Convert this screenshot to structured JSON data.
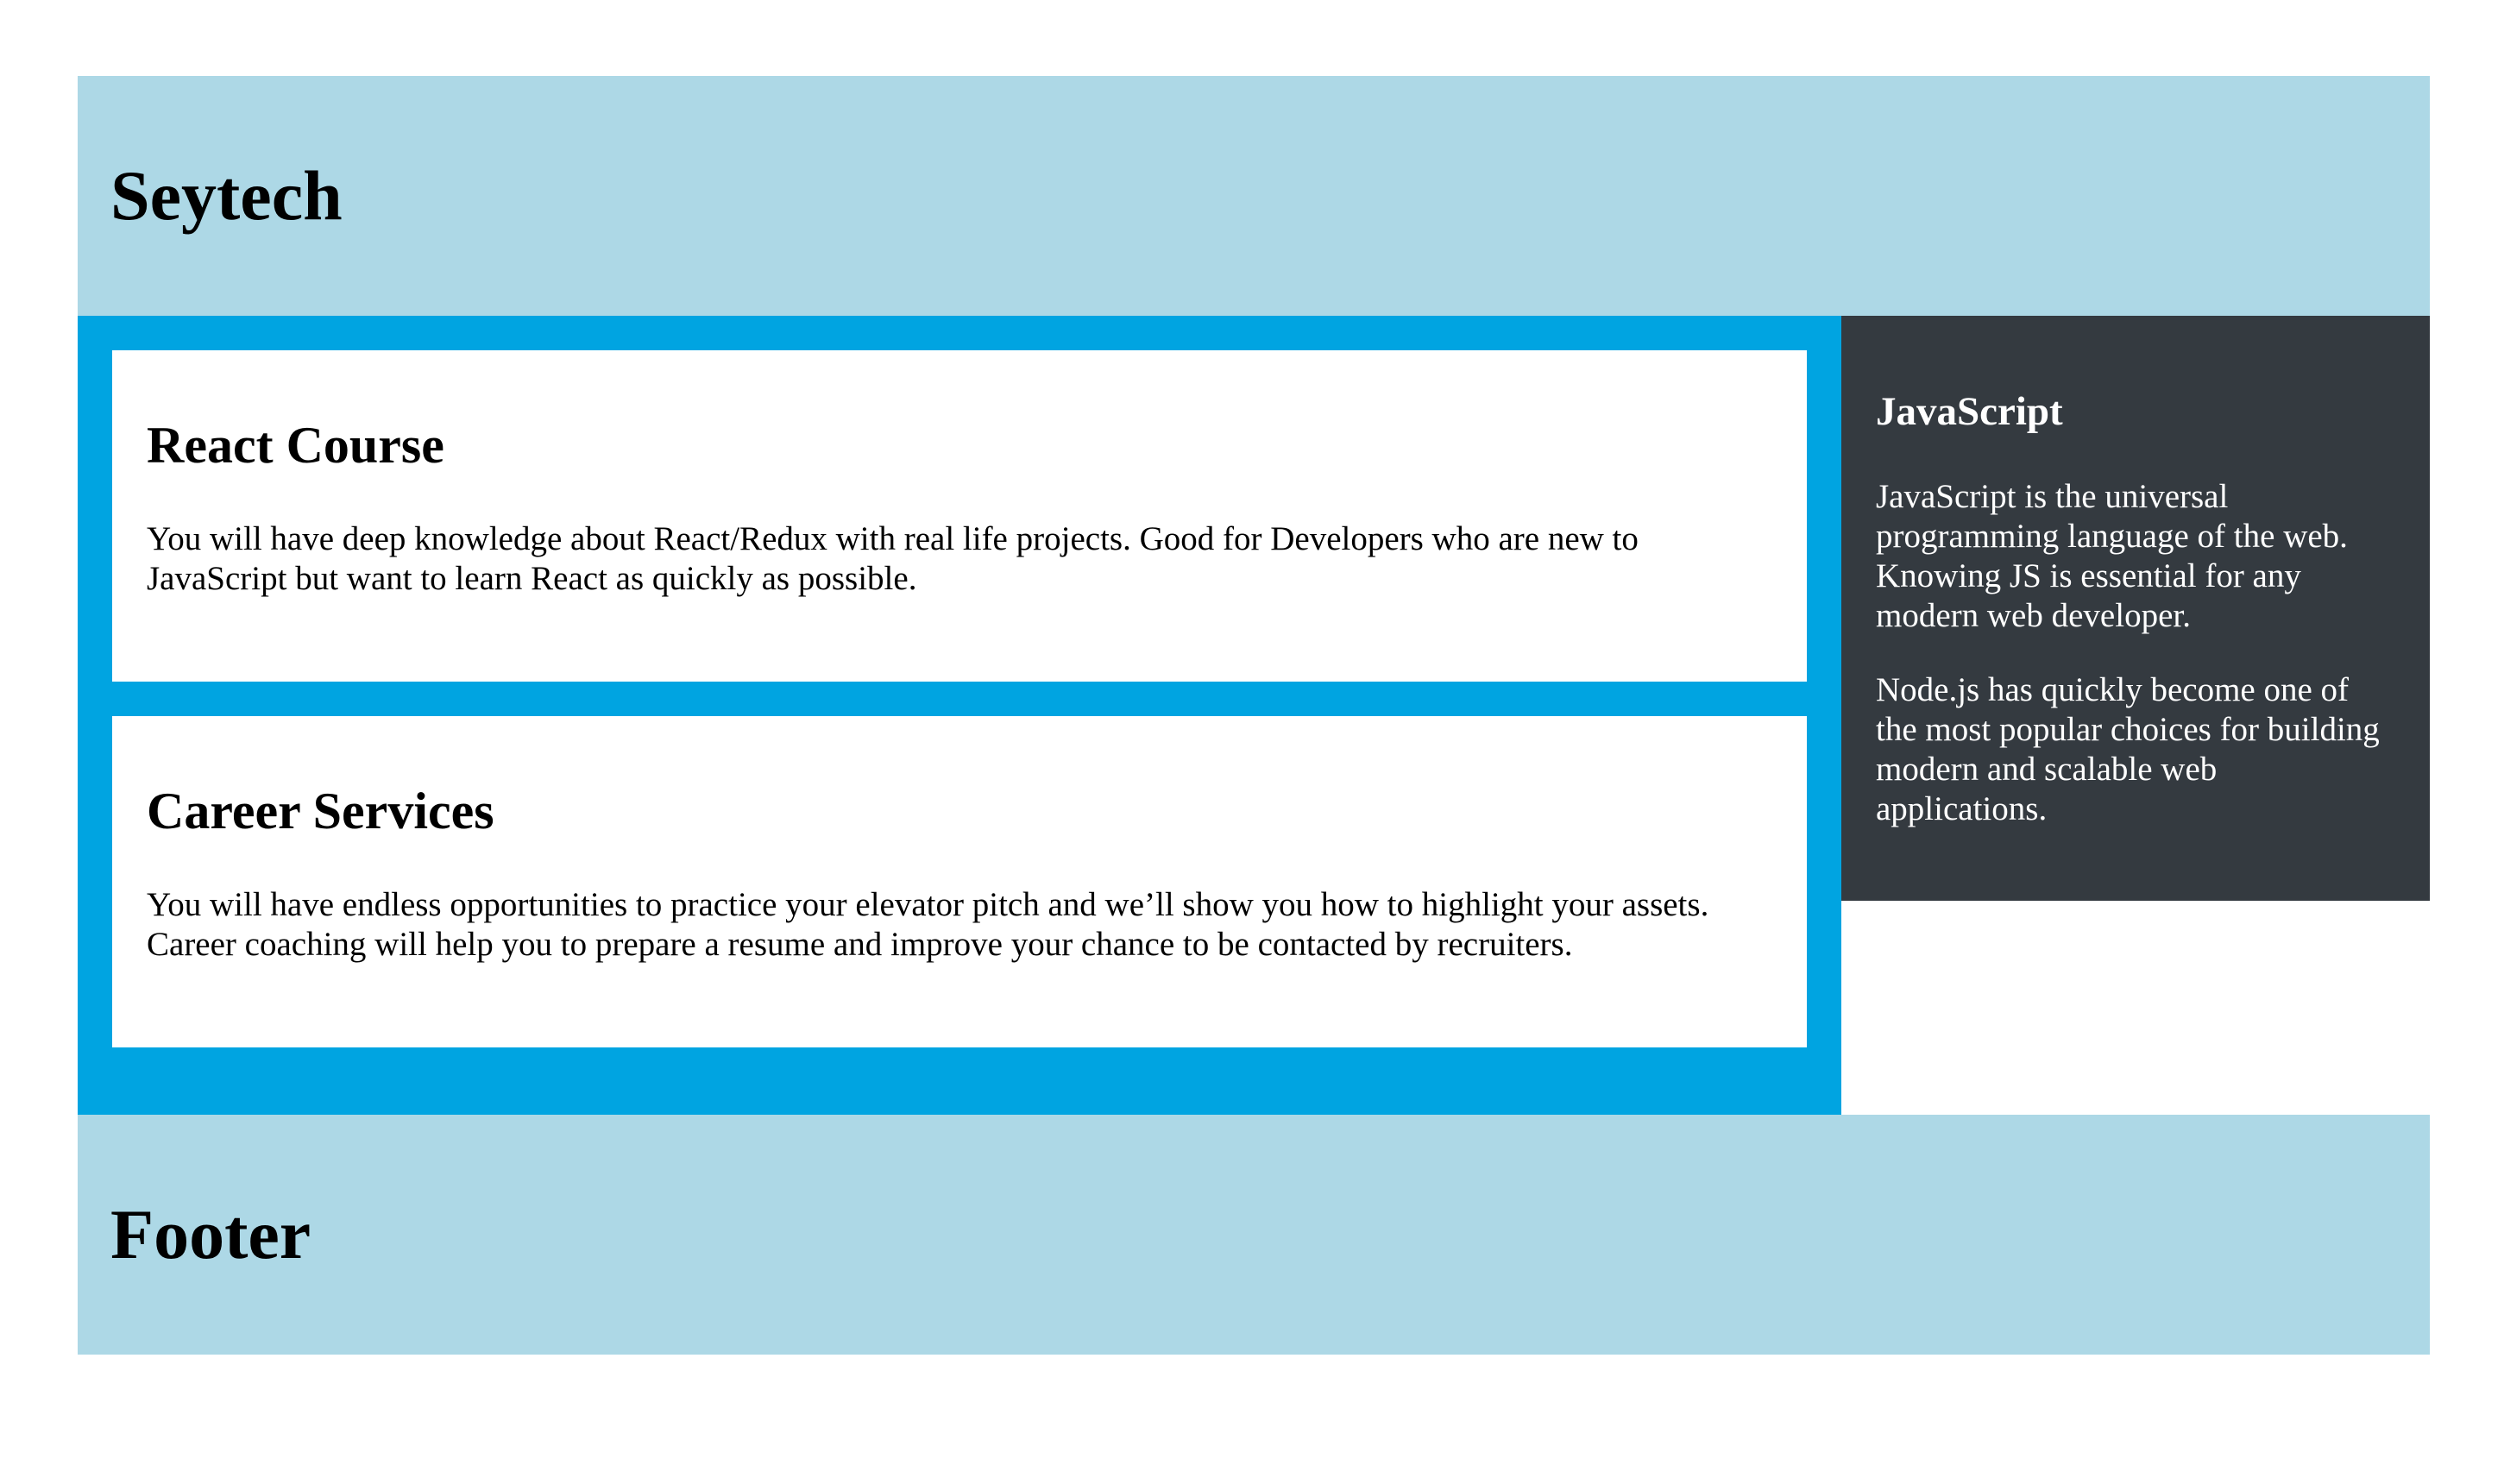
{
  "header": {
    "title": "Seytech"
  },
  "main": {
    "cards": [
      {
        "title": "React Course",
        "text": "You will have deep knowledge about React/Redux with real life projects. Good for Developers who are new to JavaScript but want to learn React as quickly as possible."
      },
      {
        "title": "Career Services",
        "text": "You will have endless opportunities to practice your elevator pitch and we’ll show you how to highlight your assets. Career coaching will help you to prepare a resume and improve your chance to be contacted by recruiters."
      }
    ]
  },
  "aside": {
    "title": "JavaScript",
    "paragraphs": [
      "JavaScript is the universal programming language of the web. Knowing JS is essential for any modern web developer.",
      "Node.js has quickly become one of the most popular choices for building modern and scalable web applications."
    ]
  },
  "footer": {
    "title": "Footer"
  },
  "colors": {
    "header_bg": "#add8e6",
    "main_bg": "#00a4e1",
    "aside_bg": "#343a40",
    "card_bg": "#ffffff"
  }
}
